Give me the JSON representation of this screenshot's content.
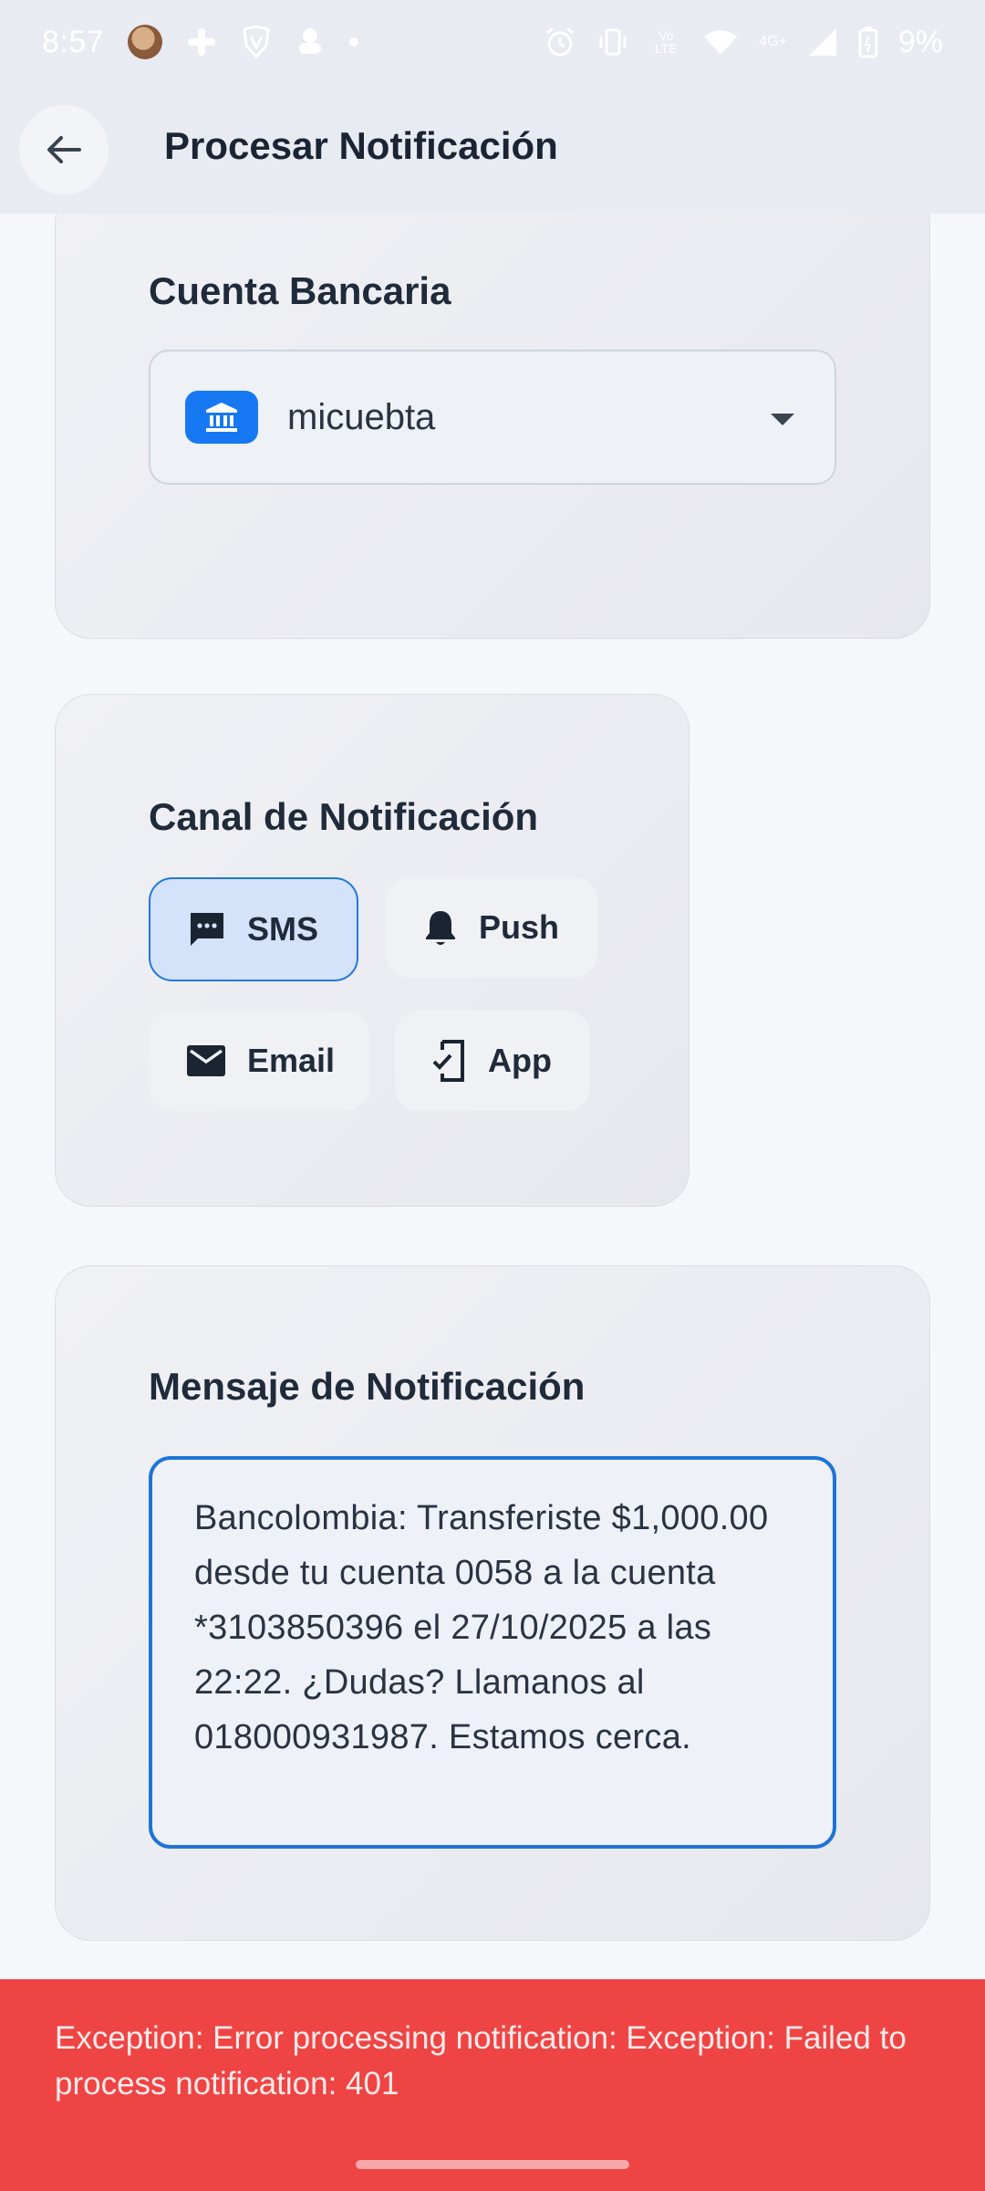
{
  "status_bar": {
    "time": "8:57",
    "battery_percent": "9%",
    "network": "4G+",
    "volte": "Vo LTE"
  },
  "app_bar": {
    "title": "Procesar Notificación"
  },
  "account_card": {
    "title": "Cuenta Bancaria",
    "selected_account": "micuebta"
  },
  "channel_card": {
    "title": "Canal de Notificación",
    "channels": [
      {
        "label": "SMS",
        "icon": "sms-icon",
        "selected": true
      },
      {
        "label": "Push",
        "icon": "bell-icon",
        "selected": false
      },
      {
        "label": "Email",
        "icon": "email-icon",
        "selected": false
      },
      {
        "label": "App",
        "icon": "phone-check-icon",
        "selected": false
      }
    ]
  },
  "message_card": {
    "title": "Mensaje de Notificación",
    "message": "Bancolombia: Transferiste $1,000.00 desde tu cuenta 0058 a la cuenta *3103850396 el 27/10/2025 a las 22:22. ¿Dudas? Llamanos al 018000931987. Estamos cerca."
  },
  "snackbar": {
    "text": "Exception: Error processing notification: Exception: Failed to process notification: 401"
  },
  "colors": {
    "accent": "#1d74d8",
    "bank_badge": "#1678f2",
    "error": "#ef4444",
    "selected_chip": "#d5e3fa"
  }
}
